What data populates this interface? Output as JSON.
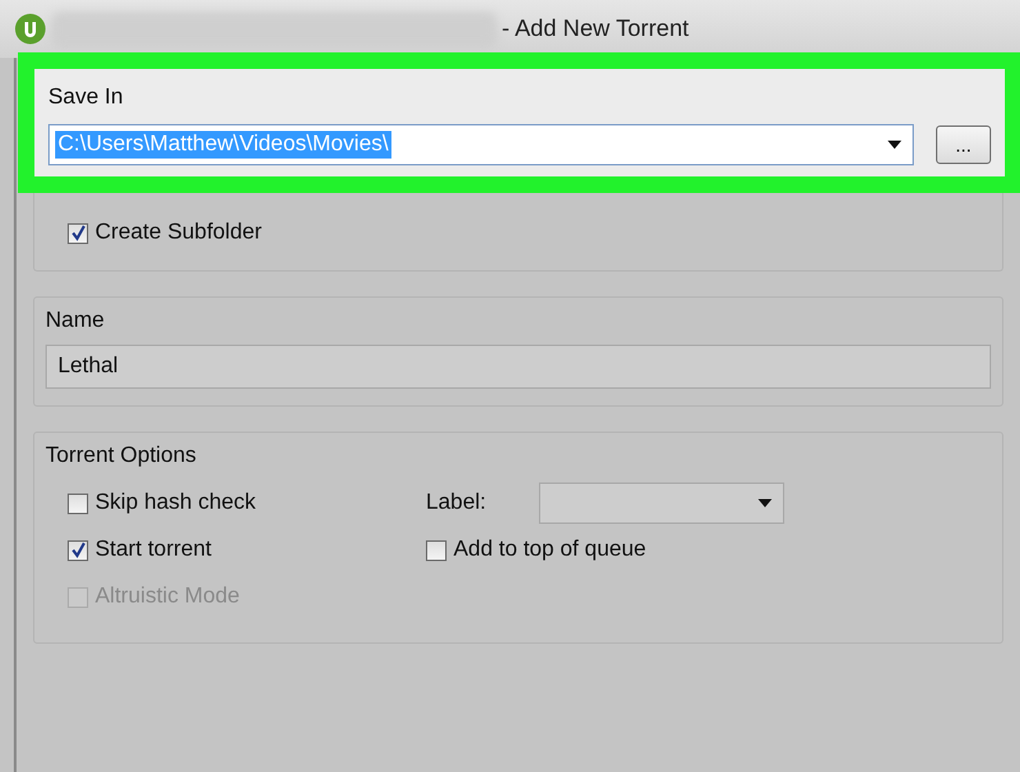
{
  "window": {
    "title": "- Add New Torrent"
  },
  "save_in": {
    "label": "Save In",
    "path": "C:\\Users\\Matthew\\Videos\\Movies\\",
    "path_selected": true,
    "browse_button": "...",
    "highlighted": true,
    "options": [
      {
        "label": "Create Subfolder",
        "checked": true,
        "disabled": false
      }
    ]
  },
  "name": {
    "label": "Name",
    "value": "Lethal"
  },
  "torrent_options": {
    "label": "Torrent Options",
    "left": [
      {
        "label": "Skip hash check",
        "checked": false,
        "disabled": false
      },
      {
        "label": "Start torrent",
        "checked": true,
        "disabled": false
      },
      {
        "label": "Altruistic Mode",
        "checked": false,
        "disabled": true
      }
    ],
    "label_field": {
      "label": "Label:"
    },
    "right": [
      {
        "label": "Add to top of queue",
        "checked": false,
        "disabled": false
      }
    ]
  }
}
